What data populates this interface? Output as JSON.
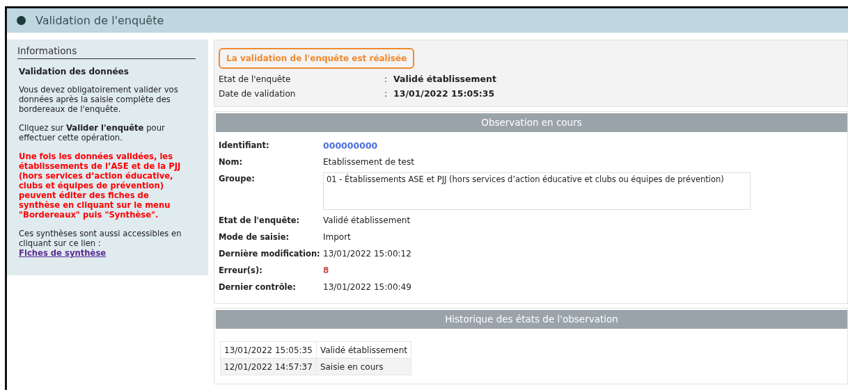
{
  "page": {
    "title": "Validation de l'enquête"
  },
  "sidebar": {
    "title": "Informations",
    "heading": "Validation des données",
    "paragraphs": [
      {
        "kind": "text",
        "text": "Vous devez obligatoirement valider vos données après la saisie complète des bordereaux de l'enquête."
      },
      {
        "kind": "text",
        "text": "Cliquez sur **Valider l'enquête** pour effectuer cette opération."
      },
      {
        "kind": "warning",
        "text": "Une fois les données validées, les établissements de l’ASE et de la PJJ (hors services d’action éducative, clubs et équipes de prévention) peuvent éditer des fiches de synthèse en cliquant sur le menu \"Bordereaux\" puis \"Synthèse\"."
      },
      {
        "kind": "link",
        "text": "Ces synthèses sont aussi accessibles en cliquant sur ce lien :",
        "link": "Fiches de synthèse"
      }
    ]
  },
  "status": {
    "message": "La validation de l'enquête est réalisée",
    "fields": [
      {
        "label": "Etat de l'enquête",
        "separator": ":",
        "value": "Validé établissement"
      },
      {
        "label": "Date de validation",
        "separator": ":",
        "value": "13/01/2022 15:05:35"
      }
    ]
  },
  "observation": {
    "title": "Observation en cours",
    "fields": [
      {
        "kind": "id",
        "label": "Identifiant:",
        "value": "000000000"
      },
      {
        "kind": "text",
        "label": "Nom:",
        "value": "Etablissement de test"
      },
      {
        "kind": "box",
        "label": "Groupe:",
        "value": "01 - Établissements ASE et PJJ (hors services d’action éducative et clubs ou équipes de prévention)"
      },
      {
        "kind": "text",
        "label": "Etat de l'enquête:",
        "value": "Validé établissement"
      },
      {
        "kind": "text",
        "label": "Mode de saisie:",
        "value": "Import"
      },
      {
        "kind": "text",
        "label": "Dernière modification:",
        "value": "13/01/2022 15:00:12"
      },
      {
        "kind": "error",
        "label": "Erreur(s):",
        "value": "8"
      },
      {
        "kind": "text",
        "label": "Dernier contrôle:",
        "value": "13/01/2022 15:00:49"
      }
    ]
  },
  "history": {
    "title": "Historique des états de l'observation",
    "rows": [
      {
        "date": "13/01/2022 15:05:35",
        "state": "Validé établissement"
      },
      {
        "date": "12/01/2022 14:57:37",
        "state": "Saisie en cours"
      }
    ]
  }
}
